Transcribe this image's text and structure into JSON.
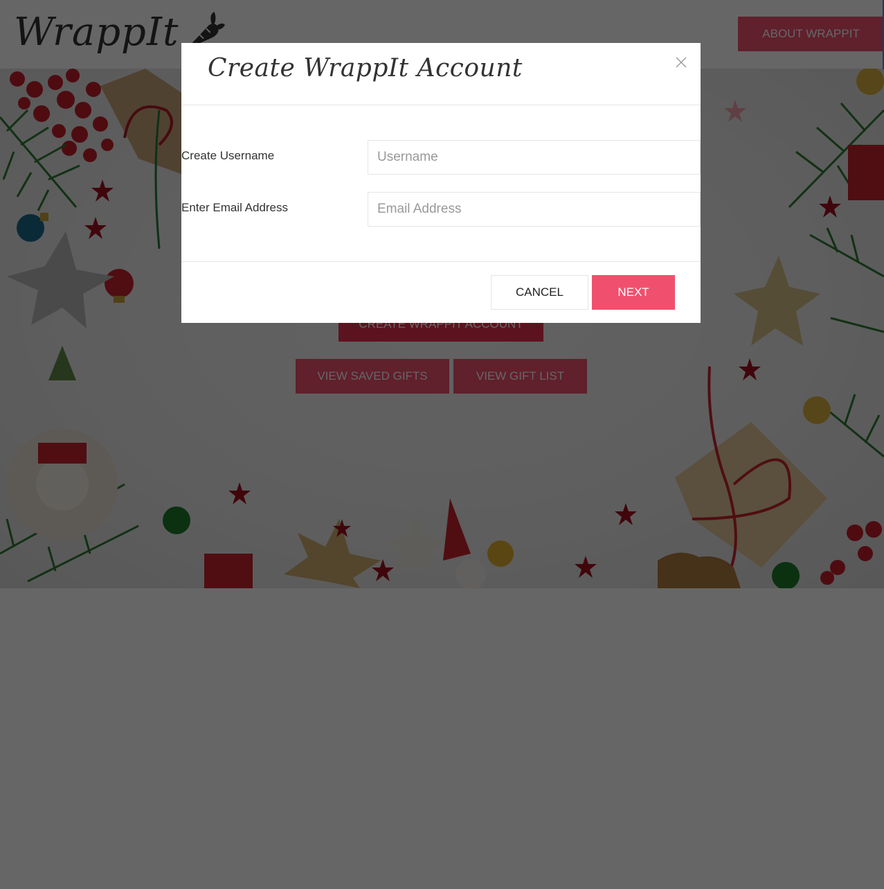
{
  "header": {
    "logo_text": "WrappIt",
    "logo_icon": "carrot-icon",
    "about_button": "ABOUT WRAPPIT"
  },
  "hero": {
    "background": "christmas-decorations-photo",
    "create_account_button": "CREATE WRAPPIT ACCOUNT",
    "view_saved_gifts_button": "VIEW SAVED GIFTS",
    "view_gift_list_button": "VIEW GIFT LIST"
  },
  "modal": {
    "title": "Create WrappIt Account",
    "close_icon": "close-icon",
    "fields": [
      {
        "label": "Create Username",
        "placeholder": "Username",
        "value": ""
      },
      {
        "label": "Enter Email Address",
        "placeholder": "Email Address",
        "value": ""
      }
    ],
    "cancel_button": "CANCEL",
    "next_button": "NEXT"
  },
  "colors": {
    "accent": "#f0506e",
    "overlay": "rgba(0,0,0,0.6)",
    "text": "#333333",
    "border": "#e5e5e5"
  }
}
